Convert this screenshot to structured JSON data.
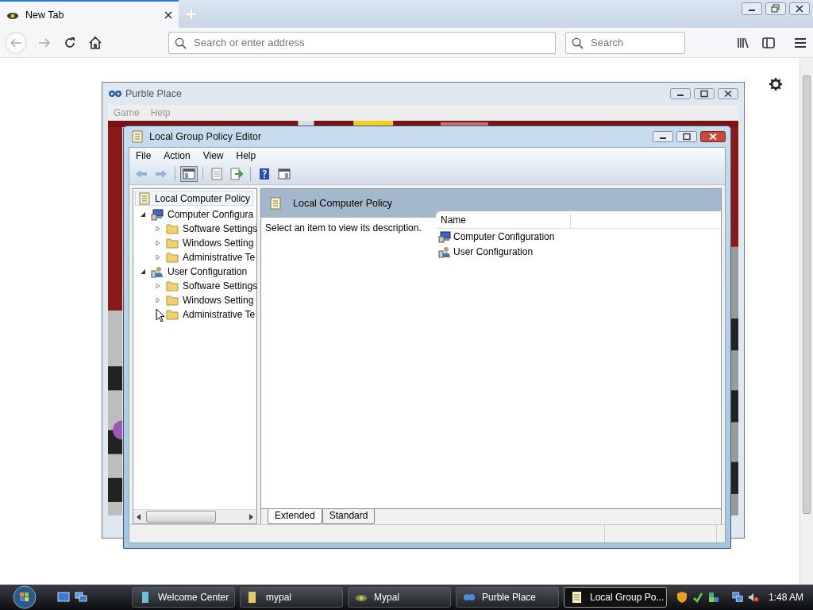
{
  "browser": {
    "tab": {
      "title": "New Tab"
    },
    "address": {
      "placeholder": "Search or enter address"
    },
    "search": {
      "placeholder": "Search"
    }
  },
  "background_window": {
    "title": "Purble Place",
    "menu": [
      "Game",
      "Help"
    ]
  },
  "window": {
    "title": "Local Group Policy Editor",
    "menu": [
      "File",
      "Action",
      "View",
      "Help"
    ],
    "toolbar": [
      {
        "kind": "back",
        "disabled": true,
        "pressed": false
      },
      {
        "kind": "forward",
        "disabled": true,
        "pressed": false
      },
      {
        "kind": "tree",
        "disabled": false,
        "pressed": true
      },
      {
        "kind": "properties",
        "disabled": false,
        "pressed": false
      },
      {
        "kind": "export",
        "disabled": false,
        "pressed": false
      },
      {
        "kind": "help",
        "disabled": false,
        "pressed": false
      },
      {
        "kind": "actionpane",
        "disabled": false,
        "pressed": false
      }
    ],
    "tree": {
      "label": "Local Computer Policy",
      "selected": true,
      "children": [
        {
          "label": "Computer Configura",
          "kind": "computer",
          "expanded": true,
          "selected": false,
          "children": [
            {
              "label": "Software Settings",
              "kind": "folder",
              "expanded": false,
              "selected": false
            },
            {
              "label": "Windows Setting",
              "kind": "folder",
              "expanded": false,
              "selected": false
            },
            {
              "label": "Administrative Te",
              "kind": "folder",
              "expanded": false,
              "selected": false
            }
          ]
        },
        {
          "label": "User Configuration",
          "kind": "user",
          "expanded": true,
          "selected": false,
          "children": [
            {
              "label": "Software Settings",
              "kind": "folder",
              "expanded": false,
              "selected": false
            },
            {
              "label": "Windows Setting",
              "kind": "folder",
              "expanded": false,
              "selected": false
            },
            {
              "label": "Administrative Te",
              "kind": "folder",
              "expanded": false,
              "selected": false
            }
          ]
        }
      ]
    },
    "pane": {
      "title": "Local Computer Policy",
      "description": "Select an item to view its description.",
      "columns": [
        "Name"
      ],
      "rows": [
        {
          "name": "Computer Configuration",
          "kind": "computer"
        },
        {
          "name": "User Configuration",
          "kind": "user"
        }
      ]
    },
    "tabs": [
      {
        "label": "Extended",
        "selected": true
      },
      {
        "label": "Standard",
        "selected": false
      }
    ]
  },
  "taskbar": {
    "items": [
      {
        "label": "Welcome Center",
        "kind": "welcome",
        "selected": false
      },
      {
        "label": "mypal",
        "kind": "folder",
        "selected": false
      },
      {
        "label": "Mypal",
        "kind": "browser",
        "selected": false
      },
      {
        "label": "Purble Place",
        "kind": "game",
        "selected": false
      },
      {
        "label": "Local Group Po...",
        "kind": "policy",
        "selected": true
      }
    ],
    "clock": "1:48 AM"
  }
}
